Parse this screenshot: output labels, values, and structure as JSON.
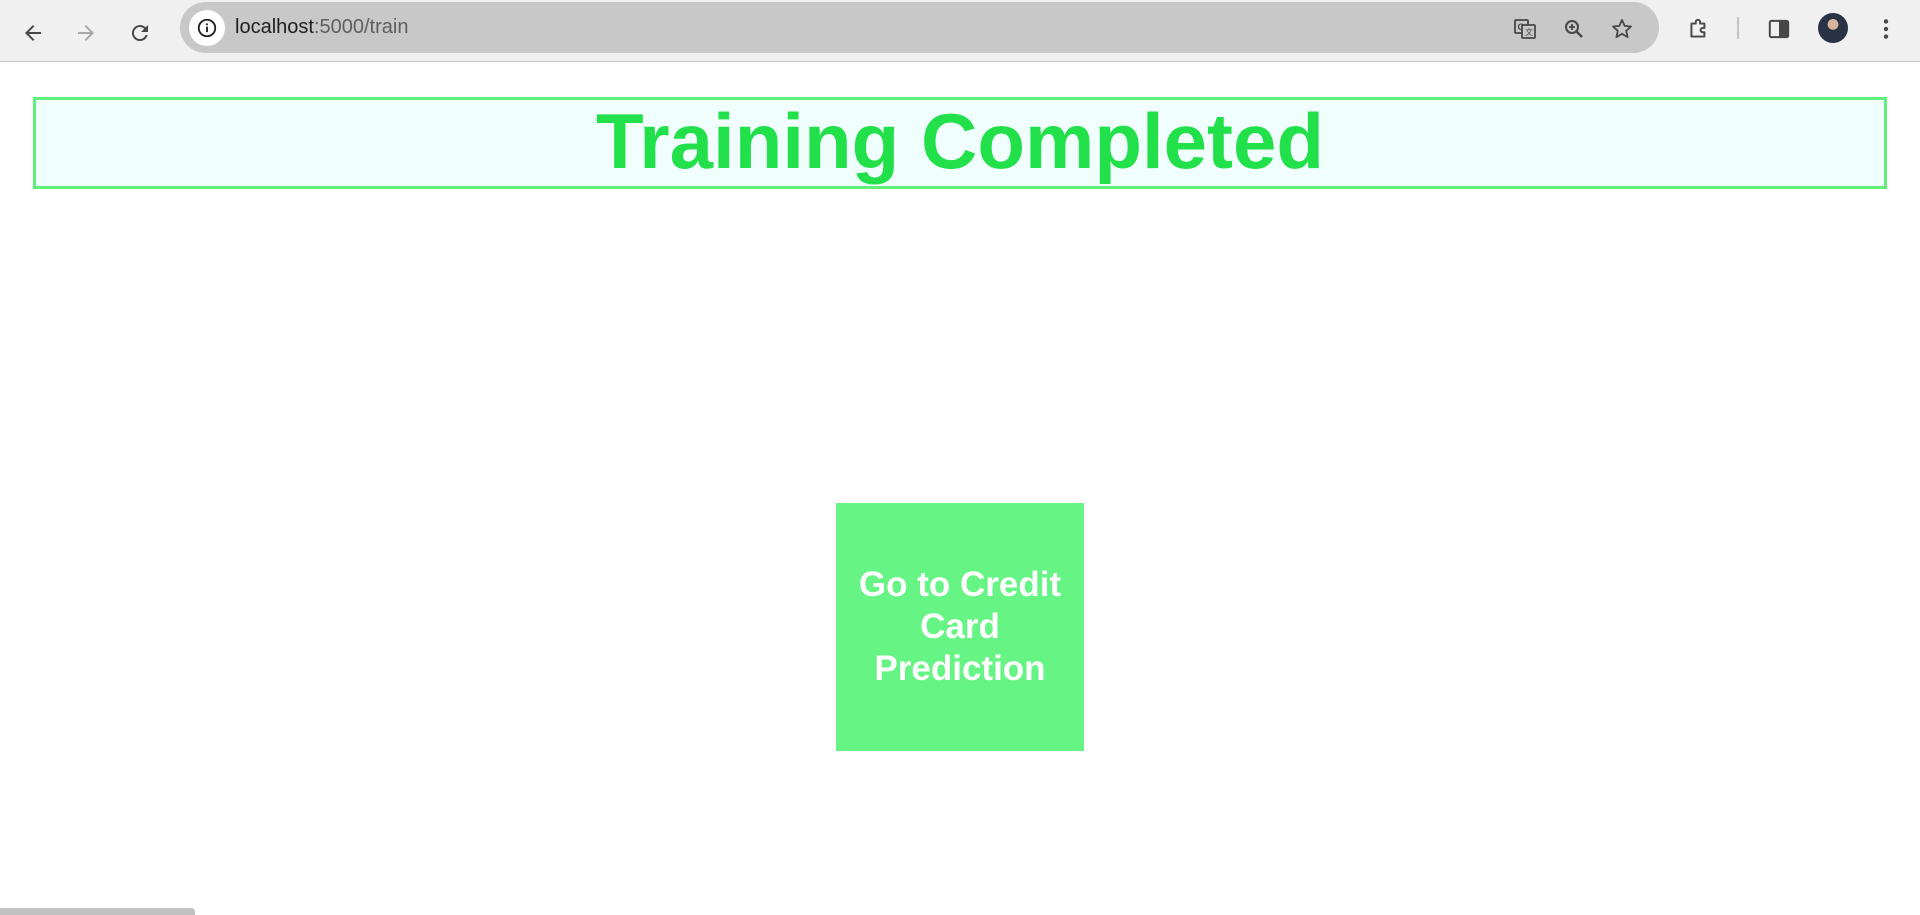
{
  "browser": {
    "url_host": "localhost",
    "url_path": ":5000/train",
    "icons": {
      "back": "arrow-left-icon",
      "forward": "arrow-right-icon",
      "reload": "reload-icon",
      "site_info": "info-icon",
      "translate": "translate-icon",
      "zoom": "zoom-icon",
      "bookmark": "star-icon",
      "extensions": "puzzle-icon",
      "side_panel": "side-panel-icon",
      "profile": "avatar",
      "menu": "kebab-menu-icon"
    }
  },
  "page": {
    "heading": "Training Completed",
    "button_label": "Go to Credit Card Prediction"
  },
  "colors": {
    "heading_text": "#22e04a",
    "banner_border": "#5ef07a",
    "banner_bg": "#f0fffe",
    "button_bg": "#66f584",
    "button_text": "#ffffff"
  }
}
